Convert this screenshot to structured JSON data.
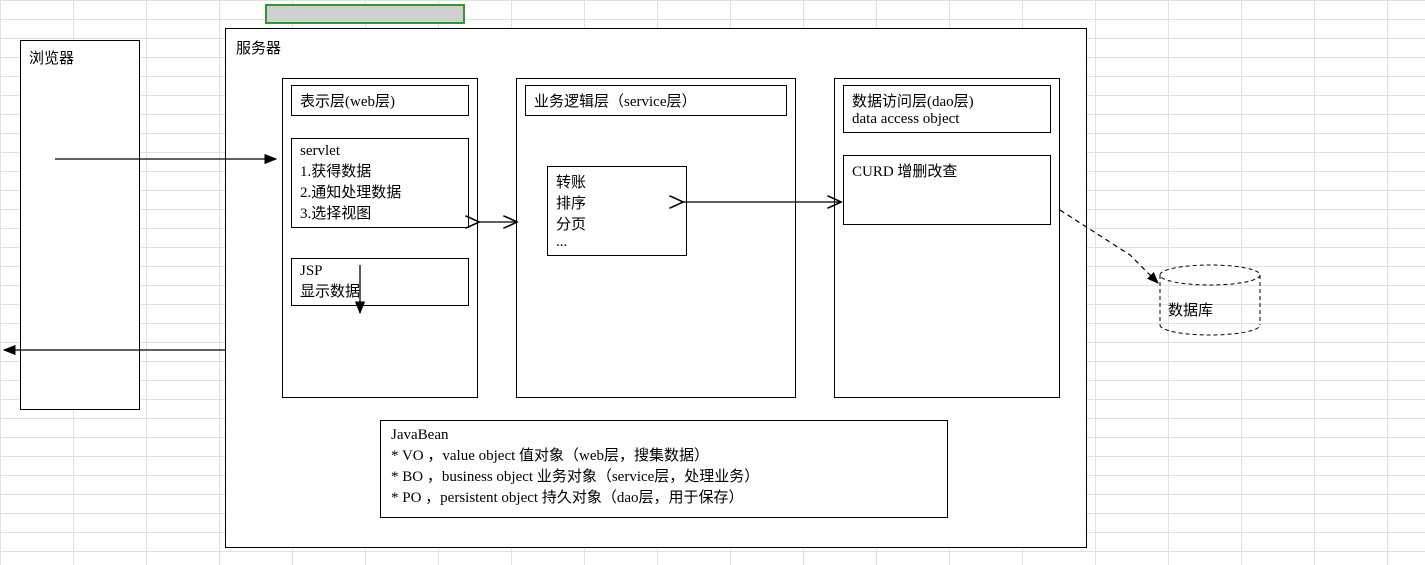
{
  "browser": {
    "title": "浏览器"
  },
  "server": {
    "title": "服务器",
    "web": {
      "title": "表示层(web层)",
      "servlet": "servlet\n1.获得数据\n2.通知处理数据\n3.选择视图",
      "jsp": "JSP\n显示数据"
    },
    "service": {
      "title": "业务逻辑层（service层）",
      "ops": "转账\n排序\n分页\n..."
    },
    "dao": {
      "title": "数据访问层(dao层)\ndata access object",
      "curd": "CURD 增删改查"
    },
    "javabean": "JavaBean\n* VO ，value object 值对象（web层，搜集数据）\n* BO ，business object 业务对象（service层，处理业务）\n* PO ，persistent object 持久对象（dao层，用于保存）"
  },
  "database": {
    "label": "数据库"
  }
}
